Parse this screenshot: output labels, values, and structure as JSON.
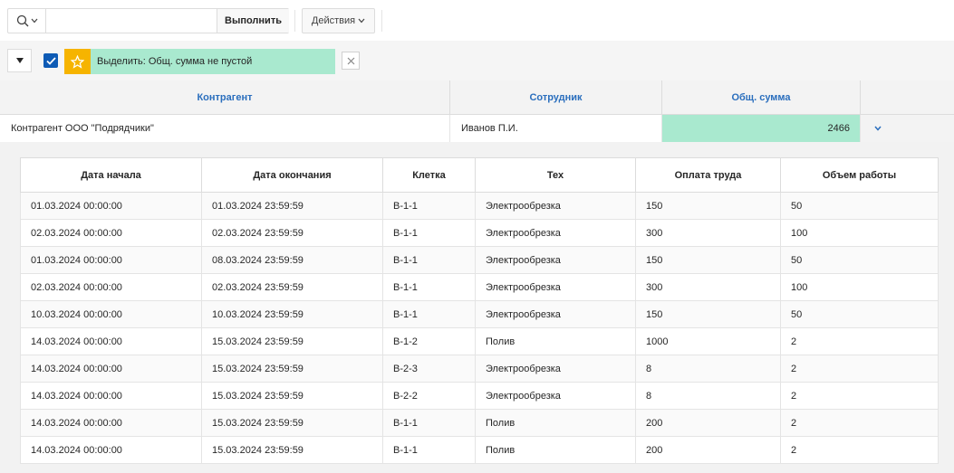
{
  "toolbar": {
    "search_placeholder": "",
    "run_label": "Выполнить",
    "actions_label": "Действия"
  },
  "filter": {
    "highlight_label": "Выделить: Общ. сумма не пустой",
    "highlight_color": "#a9e9cf",
    "star_color": "#f6b400",
    "checked": true
  },
  "master": {
    "headers": [
      "Контрагент",
      "Сотрудник",
      "Общ. сумма"
    ],
    "row": {
      "contractor": "Контрагент ООО \"Подрядчики\"",
      "employee": "Иванов П.И.",
      "total": "2466"
    }
  },
  "detail": {
    "headers": [
      "Дата начала",
      "Дата окончания",
      "Клетка",
      "Тех",
      "Оплата труда",
      "Объем работы"
    ],
    "rows": [
      [
        "01.03.2024 00:00:00",
        "01.03.2024 23:59:59",
        "В-1-1",
        "Электрообрезка",
        "150",
        "50"
      ],
      [
        "02.03.2024 00:00:00",
        "02.03.2024 23:59:59",
        "В-1-1",
        "Электрообрезка",
        "300",
        "100"
      ],
      [
        "01.03.2024 00:00:00",
        "08.03.2024 23:59:59",
        "В-1-1",
        "Электрообрезка",
        "150",
        "50"
      ],
      [
        "02.03.2024 00:00:00",
        "02.03.2024 23:59:59",
        "В-1-1",
        "Электрообрезка",
        "300",
        "100"
      ],
      [
        "10.03.2024 00:00:00",
        "10.03.2024 23:59:59",
        "В-1-1",
        "Электрообрезка",
        "150",
        "50"
      ],
      [
        "14.03.2024 00:00:00",
        "15.03.2024 23:59:59",
        "В-1-2",
        "Полив",
        "1000",
        "2"
      ],
      [
        "14.03.2024 00:00:00",
        "15.03.2024 23:59:59",
        "В-2-3",
        "Электрообрезка",
        "8",
        "2"
      ],
      [
        "14.03.2024 00:00:00",
        "15.03.2024 23:59:59",
        "В-2-2",
        "Электрообрезка",
        "8",
        "2"
      ],
      [
        "14.03.2024 00:00:00",
        "15.03.2024 23:59:59",
        "В-1-1",
        "Полив",
        "200",
        "2"
      ],
      [
        "14.03.2024 00:00:00",
        "15.03.2024 23:59:59",
        "В-1-1",
        "Полив",
        "200",
        "2"
      ]
    ]
  },
  "icons": {
    "search": "search-icon",
    "chevron_down": "chevron-down-icon",
    "star": "star-icon",
    "close": "close-icon",
    "check": "checkmark-icon",
    "triangle": "triangle-down-icon"
  }
}
